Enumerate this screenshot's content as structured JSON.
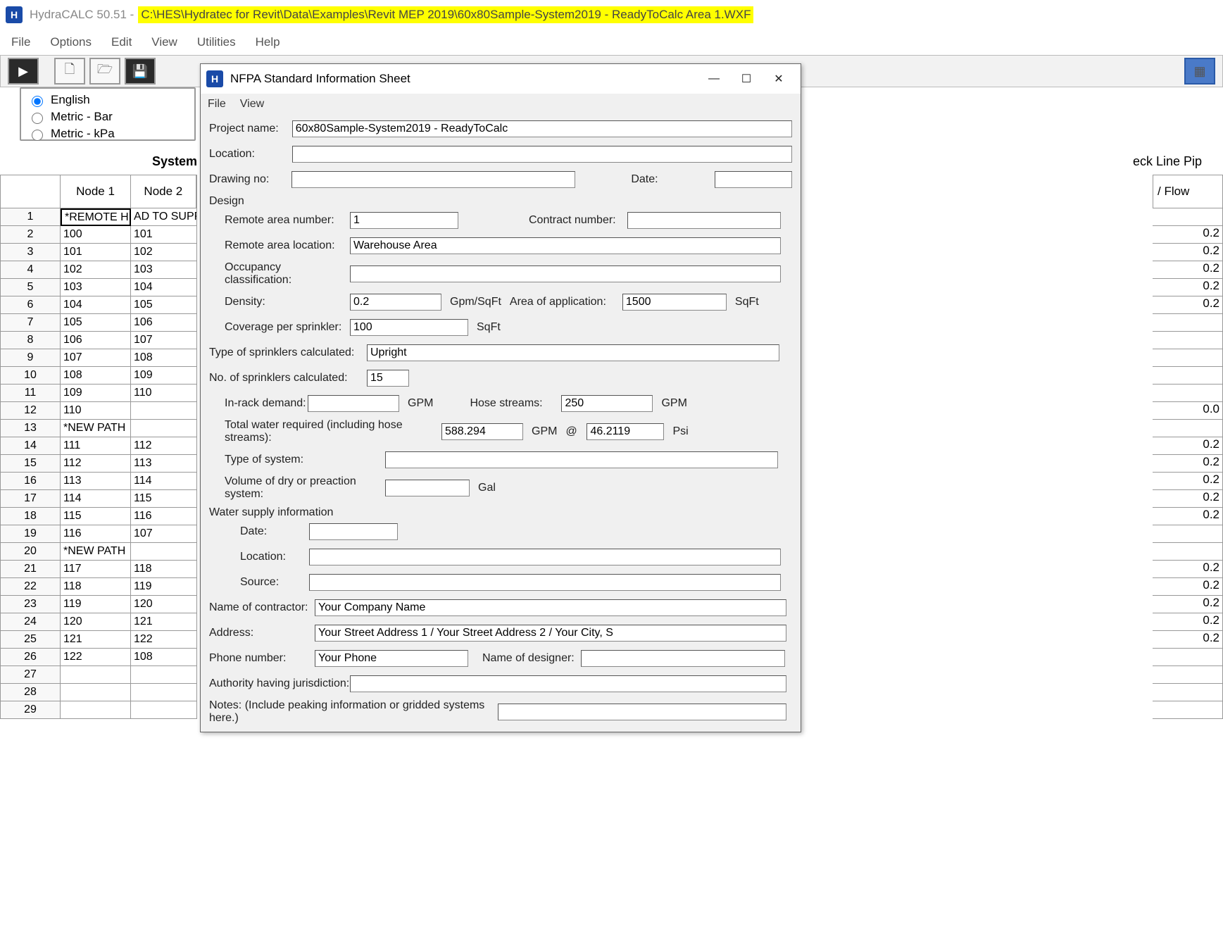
{
  "titlebar": {
    "app_name": "HydraCALC 50.51 - ",
    "file_path": "C:\\HES\\Hydratec for Revit\\Data\\Examples\\Revit MEP 2019\\60x80Sample-System2019 - ReadyToCalc Area 1.WXF"
  },
  "main_menu": [
    "File",
    "Options",
    "Edit",
    "View",
    "Utilities",
    "Help"
  ],
  "units": {
    "english": "English",
    "metric_bar": "Metric - Bar",
    "metric_kpa": "Metric - kPa"
  },
  "sys_header_left": "System Pip",
  "sys_header_right": "eck Line Pip",
  "grid": {
    "headers": {
      "node1": "Node 1",
      "node2": "Node 2"
    },
    "rows": [
      {
        "r": "1",
        "n1": "*REMOTE HEAD",
        "n2": "AD TO SUPP"
      },
      {
        "r": "2",
        "n1": "100",
        "n2": "101"
      },
      {
        "r": "3",
        "n1": "101",
        "n2": "102"
      },
      {
        "r": "4",
        "n1": "102",
        "n2": "103"
      },
      {
        "r": "5",
        "n1": "103",
        "n2": "104"
      },
      {
        "r": "6",
        "n1": "104",
        "n2": "105"
      },
      {
        "r": "7",
        "n1": "105",
        "n2": "106"
      },
      {
        "r": "8",
        "n1": "106",
        "n2": "107"
      },
      {
        "r": "9",
        "n1": "107",
        "n2": "108"
      },
      {
        "r": "10",
        "n1": "108",
        "n2": "109"
      },
      {
        "r": "11",
        "n1": "109",
        "n2": "110"
      },
      {
        "r": "12",
        "n1": "110",
        "n2": ""
      },
      {
        "r": "13",
        "n1": "*NEW PATH",
        "n2": ""
      },
      {
        "r": "14",
        "n1": "111",
        "n2": "112"
      },
      {
        "r": "15",
        "n1": "112",
        "n2": "113"
      },
      {
        "r": "16",
        "n1": "113",
        "n2": "114"
      },
      {
        "r": "17",
        "n1": "114",
        "n2": "115"
      },
      {
        "r": "18",
        "n1": "115",
        "n2": "116"
      },
      {
        "r": "19",
        "n1": "116",
        "n2": "107"
      },
      {
        "r": "20",
        "n1": "*NEW PATH",
        "n2": ""
      },
      {
        "r": "21",
        "n1": "117",
        "n2": "118"
      },
      {
        "r": "22",
        "n1": "118",
        "n2": "119"
      },
      {
        "r": "23",
        "n1": "119",
        "n2": "120"
      },
      {
        "r": "24",
        "n1": "120",
        "n2": "121"
      },
      {
        "r": "25",
        "n1": "121",
        "n2": "122"
      },
      {
        "r": "26",
        "n1": "122",
        "n2": "108"
      },
      {
        "r": "27",
        "n1": "",
        "n2": ""
      },
      {
        "r": "28",
        "n1": "",
        "n2": ""
      },
      {
        "r": "29",
        "n1": "",
        "n2": ""
      }
    ]
  },
  "right_col": {
    "header": "/ Flow",
    "vals": [
      "",
      "0.2",
      "0.2",
      "0.2",
      "0.2",
      "0.2",
      "",
      "",
      "",
      "",
      "",
      "0.0",
      "",
      "0.2",
      "0.2",
      "0.2",
      "0.2",
      "0.2",
      "",
      "",
      "0.2",
      "0.2",
      "0.2",
      "0.2",
      "0.2",
      "",
      "",
      "",
      ""
    ]
  },
  "popup": {
    "title": "NFPA Standard Information Sheet",
    "menu": [
      "File",
      "View"
    ],
    "labels": {
      "project_name": "Project name:",
      "location": "Location:",
      "drawing_no": "Drawing no:",
      "date": "Date:",
      "design": "Design",
      "remote_area_number": "Remote area number:",
      "contract_number": "Contract number:",
      "remote_area_location": "Remote area location:",
      "occupancy": "Occupancy classification:",
      "density": "Density:",
      "gpm_sqft": "Gpm/SqFt",
      "area_app": "Area of application:",
      "sqft": "SqFt",
      "coverage": "Coverage per sprinkler:",
      "type_sprinklers": "Type of sprinklers calculated:",
      "no_sprinklers": "No. of sprinklers calculated:",
      "inrack": "In-rack demand:",
      "gpm": "GPM",
      "hose": "Hose streams:",
      "total_water": "Total water required (including hose streams):",
      "at": "@",
      "psi": "Psi",
      "type_system": "Type of system:",
      "volume": "Volume of dry or preaction system:",
      "gal": "Gal",
      "water_supply": "Water supply information",
      "ws_date": "Date:",
      "ws_location": "Location:",
      "ws_source": "Source:",
      "contractor": "Name of contractor:",
      "address": "Address:",
      "phone": "Phone number:",
      "designer": "Name of designer:",
      "authority": "Authority having jurisdiction:",
      "notes": "Notes: (Include peaking information or gridded systems here.)"
    },
    "values": {
      "project_name": "60x80Sample-System2019 - ReadyToCalc",
      "location": "",
      "drawing_no": "",
      "date": "",
      "remote_area_number": "1",
      "contract_number": "",
      "remote_area_location": "Warehouse Area",
      "occupancy": "",
      "density": "0.2",
      "area_app": "1500",
      "coverage": "100",
      "type_sprinklers": "Upright",
      "no_sprinklers": "15",
      "inrack": "",
      "hose": "250",
      "total_gpm": "588.294",
      "total_psi": "46.2119",
      "type_system": "",
      "volume": "",
      "ws_date": "",
      "ws_location": "",
      "ws_source": "",
      "contractor": "Your Company Name",
      "address": "Your Street Address 1 / Your Street Address 2 / Your City, S",
      "phone": "Your Phone",
      "designer": "",
      "authority": "",
      "notes": ""
    }
  }
}
